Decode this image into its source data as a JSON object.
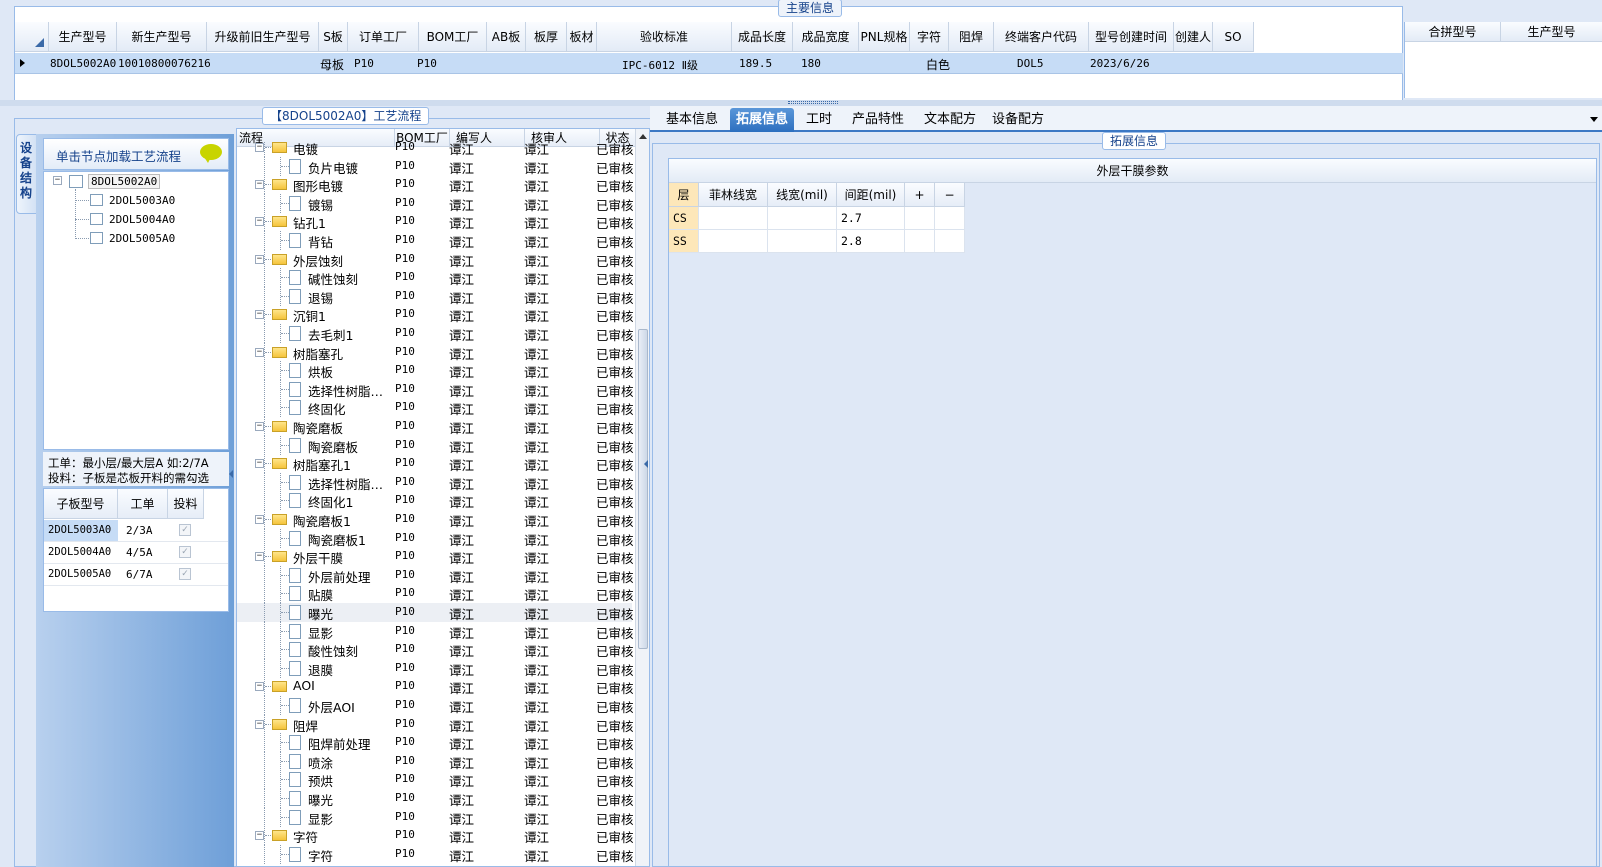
{
  "main_section": {
    "caption": "主要信息",
    "columns": [
      "生产型号",
      "新生产型号",
      "升级前旧生产型号",
      "S板",
      "订单工厂",
      "BOM工厂",
      "AB板",
      "板厚",
      "板材",
      "验收标准",
      "成品长度",
      "成品宽度",
      "PNL规格",
      "字符",
      "阻焊",
      "终端客户代码",
      "型号创建时间",
      "创建人",
      "SO"
    ],
    "row": {
      "prod_model": "8DOL5002A0",
      "new_model": "10010800076216",
      "s_board": "母板",
      "order_factory": "P10",
      "bom_factory": "P10",
      "standard": "IPC-6012 Ⅱ级",
      "length": "189.5",
      "width": "180",
      "char": "白色",
      "customer": "DOL5",
      "created": "2023/6/26"
    },
    "merge_columns": [
      "合拼型号",
      "生产型号"
    ]
  },
  "process_panel": {
    "caption": "【8DOL5002A0】工艺流程",
    "side_tab": "设备结构",
    "hint": "单击节点加载工艺流程",
    "tree_root": "8DOL5002A0",
    "tree_children": [
      "2DOL5003A0",
      "2DOL5004A0",
      "2DOL5005A0"
    ],
    "note_line1": "工单：最小层/最大层A 如:2/7A",
    "note_line2": "投料：子板是芯板开料的需勾选",
    "sub_columns": [
      "子板型号",
      "工单",
      "投料"
    ],
    "sub_rows": [
      {
        "model": "2DOL5003A0",
        "order": "2/3A",
        "feed": "✓"
      },
      {
        "model": "2DOL5004A0",
        "order": "4/5A",
        "feed": "✓"
      },
      {
        "model": "2DOL5005A0",
        "order": "6/7A",
        "feed": "✓"
      }
    ]
  },
  "flow_tree": {
    "columns": [
      "流程",
      "BOM工厂",
      "编写人",
      "核审人",
      "状态"
    ],
    "factory": "P10",
    "writer": "谭江",
    "reviewer": "谭江",
    "status": "已审核",
    "rows": [
      {
        "name": "电镀",
        "type": "folder"
      },
      {
        "name": "负片电镀",
        "type": "doc"
      },
      {
        "name": "图形电镀",
        "type": "folder"
      },
      {
        "name": "镀锡",
        "type": "doc"
      },
      {
        "name": "钻孔1",
        "type": "folder"
      },
      {
        "name": "背钻",
        "type": "doc"
      },
      {
        "name": "外层蚀刻",
        "type": "folder"
      },
      {
        "name": "碱性蚀刻",
        "type": "doc"
      },
      {
        "name": "退锡",
        "type": "doc"
      },
      {
        "name": "沉铜1",
        "type": "folder"
      },
      {
        "name": "去毛刺1",
        "type": "doc"
      },
      {
        "name": "树脂塞孔",
        "type": "folder"
      },
      {
        "name": "烘板",
        "type": "doc"
      },
      {
        "name": "选择性树脂…",
        "type": "doc"
      },
      {
        "name": "终固化",
        "type": "doc"
      },
      {
        "name": "陶瓷磨板",
        "type": "folder"
      },
      {
        "name": "陶瓷磨板",
        "type": "doc"
      },
      {
        "name": "树脂塞孔1",
        "type": "folder"
      },
      {
        "name": "选择性树脂…",
        "type": "doc"
      },
      {
        "name": "终固化1",
        "type": "doc"
      },
      {
        "name": "陶瓷磨板1",
        "type": "folder"
      },
      {
        "name": "陶瓷磨板1",
        "type": "doc"
      },
      {
        "name": "外层干膜",
        "type": "folder"
      },
      {
        "name": "外层前处理",
        "type": "doc"
      },
      {
        "name": "贴膜",
        "type": "doc"
      },
      {
        "name": "曝光",
        "type": "doc",
        "selected": true
      },
      {
        "name": "显影",
        "type": "doc"
      },
      {
        "name": "酸性蚀刻",
        "type": "doc"
      },
      {
        "name": "退膜",
        "type": "doc"
      },
      {
        "name": "AOI",
        "type": "folder"
      },
      {
        "name": "外层AOI",
        "type": "doc"
      },
      {
        "name": "阻焊",
        "type": "folder"
      },
      {
        "name": "阻焊前处理",
        "type": "doc"
      },
      {
        "name": "喷涂",
        "type": "doc"
      },
      {
        "name": "预烘",
        "type": "doc"
      },
      {
        "name": "曝光",
        "type": "doc"
      },
      {
        "name": "显影",
        "type": "doc"
      },
      {
        "name": "字符",
        "type": "folder"
      },
      {
        "name": "字符",
        "type": "doc"
      }
    ]
  },
  "detail": {
    "tabs": [
      "基本信息",
      "拓展信息",
      "工时",
      "产品特性",
      "文本配方",
      "设备配方"
    ],
    "active_tab": 1,
    "group_caption": "拓展信息",
    "table_title": "外层干膜参数",
    "param_columns": [
      "层",
      "菲林线宽",
      "线宽(mil)",
      "间距(mil)",
      "+",
      "−"
    ],
    "param_rows": [
      {
        "layer": "CS",
        "film": "",
        "width": "",
        "spacing": "2.7"
      },
      {
        "layer": "SS",
        "film": "",
        "width": "",
        "spacing": "2.8"
      }
    ]
  },
  "colors": {
    "selection": "#c6dcf6",
    "header_accent": "#fde7b9",
    "active_tab": "#2c6fbf"
  }
}
